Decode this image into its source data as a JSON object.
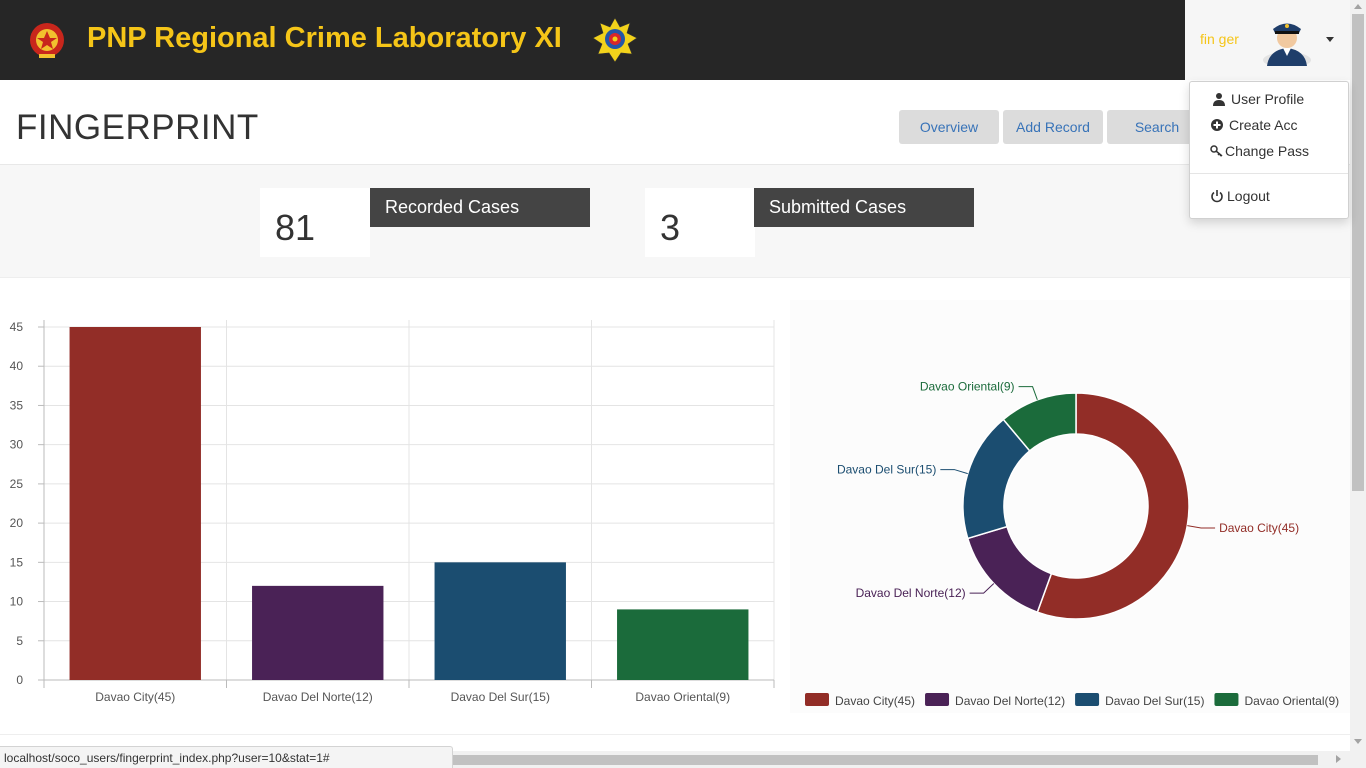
{
  "header": {
    "brand_title": "PNP Regional Crime Laboratory XI",
    "username": "fin ger",
    "colors": {
      "bar": "#262626",
      "brand": "#f5c518"
    }
  },
  "user_menu": {
    "items": [
      {
        "label": "User Profile",
        "icon": "user-icon"
      },
      {
        "label": "Create Acc",
        "icon": "plus-circle-icon"
      },
      {
        "label": "Change Pass",
        "icon": "key-icon"
      },
      {
        "label": "Logout",
        "icon": "power-icon"
      }
    ]
  },
  "page": {
    "title": "FINGERPRINT",
    "nav_buttons": [
      "Overview",
      "Add Record",
      "Search"
    ]
  },
  "stats": [
    {
      "value": "81",
      "label": "Recorded Cases"
    },
    {
      "value": "3",
      "label": "Submitted Cases"
    }
  ],
  "chart_data": [
    {
      "type": "bar",
      "categories": [
        "Davao City(45)",
        "Davao Del Norte(12)",
        "Davao Del Sur(15)",
        "Davao Oriental(9)"
      ],
      "values": [
        45,
        12,
        15,
        9
      ],
      "colors": [
        "#922d27",
        "#4a2256",
        "#1b4d70",
        "#1b6b3b"
      ],
      "ylim": [
        0,
        45
      ],
      "yticks": [
        0,
        5,
        10,
        15,
        20,
        25,
        30,
        35,
        40,
        45
      ],
      "grid": true
    },
    {
      "type": "pie",
      "variant": "doughnut",
      "labels": [
        "Davao City(45)",
        "Davao Del Norte(12)",
        "Davao Del Sur(15)",
        "Davao Oriental(9)"
      ],
      "values": [
        45,
        12,
        15,
        9
      ],
      "colors": [
        "#922d27",
        "#4a2256",
        "#1b4d70",
        "#1b6b3b"
      ],
      "legend": "bottom"
    }
  ],
  "status_bar": {
    "url": "localhost/soco_users/fingerprint_index.php?user=10&stat=1#"
  }
}
